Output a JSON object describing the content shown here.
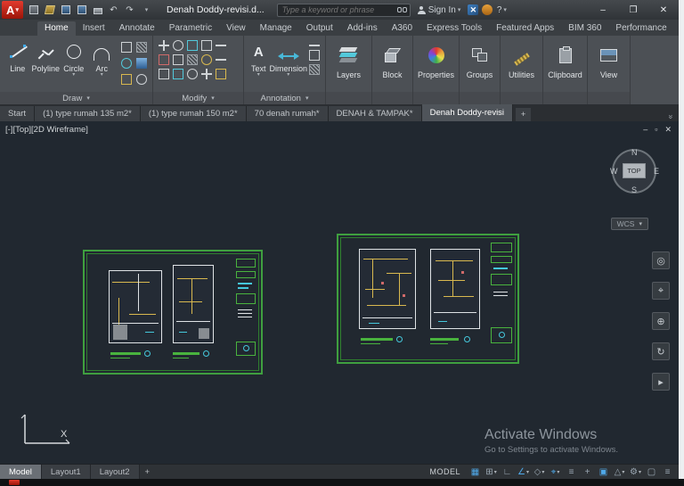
{
  "glyphs": {
    "logo": "A",
    "logo_chevron": "▾",
    "chevron": "▾",
    "overflow": "»",
    "undo": "↶",
    "redo": "↷",
    "doc_min": "–",
    "doc_restore": "▫",
    "doc_close": "✕",
    "text_tool": "A",
    "help": "?",
    "plus": "+"
  },
  "titlebar": {
    "title": "Denah Doddy-revisi.d...",
    "search_placeholder": "Type a keyword or phrase",
    "sign_in": "Sign In",
    "window": {
      "minimize": "–",
      "maximize": "❐",
      "close": "✕"
    }
  },
  "ribbon_tabs": [
    "Home",
    "Insert",
    "Annotate",
    "Parametric",
    "View",
    "Manage",
    "Output",
    "Add-ins",
    "A360",
    "Express Tools",
    "Featured Apps",
    "BIM 360",
    "Performance"
  ],
  "panels": {
    "draw": {
      "title": "Draw",
      "line": "Line",
      "polyline": "Polyline",
      "circle": "Circle",
      "arc": "Arc"
    },
    "modify": {
      "title": "Modify"
    },
    "annotation": {
      "title": "Annotation",
      "text": "Text",
      "dimension": "Dimension"
    },
    "layers": "Layers",
    "block": "Block",
    "properties": "Properties",
    "groups": "Groups",
    "utilities": "Utilities",
    "clipboard": "Clipboard",
    "view": "View"
  },
  "file_tabs": [
    "Start",
    "(1) type rumah 135 m2*",
    "(1) type rumah 150 m2*",
    "70 denah rumah*",
    "DENAH & TAMPAK*",
    "Denah Doddy-revisi"
  ],
  "viewport": {
    "corner_label": "[-][Top][2D Wireframe]",
    "viewcube": {
      "north": "N",
      "south": "S",
      "east": "E",
      "west": "W",
      "top": "TOP"
    },
    "wcs": "WCS",
    "watermark_title": "Activate Windows",
    "watermark_sub": "Go to Settings to activate Windows."
  },
  "navbar_icons": [
    {
      "name": "navigation-wheel",
      "glyph": "◎"
    },
    {
      "name": "pan",
      "glyph": "⌖"
    },
    {
      "name": "zoom",
      "glyph": "⊕"
    },
    {
      "name": "orbit",
      "glyph": "↻"
    },
    {
      "name": "show-motion",
      "glyph": "▸"
    }
  ],
  "layout_tabs": {
    "model": "Model",
    "layout1": "Layout1",
    "layout2": "Layout2",
    "add": "+"
  },
  "statusbar": {
    "model_label": "MODEL",
    "icons": [
      {
        "name": "grid-display",
        "glyph": "▦",
        "active": true
      },
      {
        "name": "snap-mode",
        "glyph": "⊞",
        "active": false
      },
      {
        "name": "ortho-mode",
        "glyph": "∟",
        "active": false
      },
      {
        "name": "polar-tracking",
        "glyph": "∠",
        "active": true
      },
      {
        "name": "isometric-drafting",
        "glyph": "◇",
        "active": false
      },
      {
        "name": "object-snap",
        "glyph": "⌖",
        "active": true
      },
      {
        "name": "lineweight",
        "glyph": "≡",
        "active": false
      },
      {
        "name": "dynamic-input",
        "glyph": "+",
        "active": false
      },
      {
        "name": "selection-cycling",
        "glyph": "▣",
        "active": true
      },
      {
        "name": "annotation-scale",
        "glyph": "△",
        "active": false
      },
      {
        "name": "workspace-switching",
        "glyph": "⚙",
        "active": false
      },
      {
        "name": "annotation-monitor",
        "glyph": "▢",
        "active": false
      },
      {
        "name": "customize",
        "glyph": "≡",
        "active": false
      }
    ]
  }
}
